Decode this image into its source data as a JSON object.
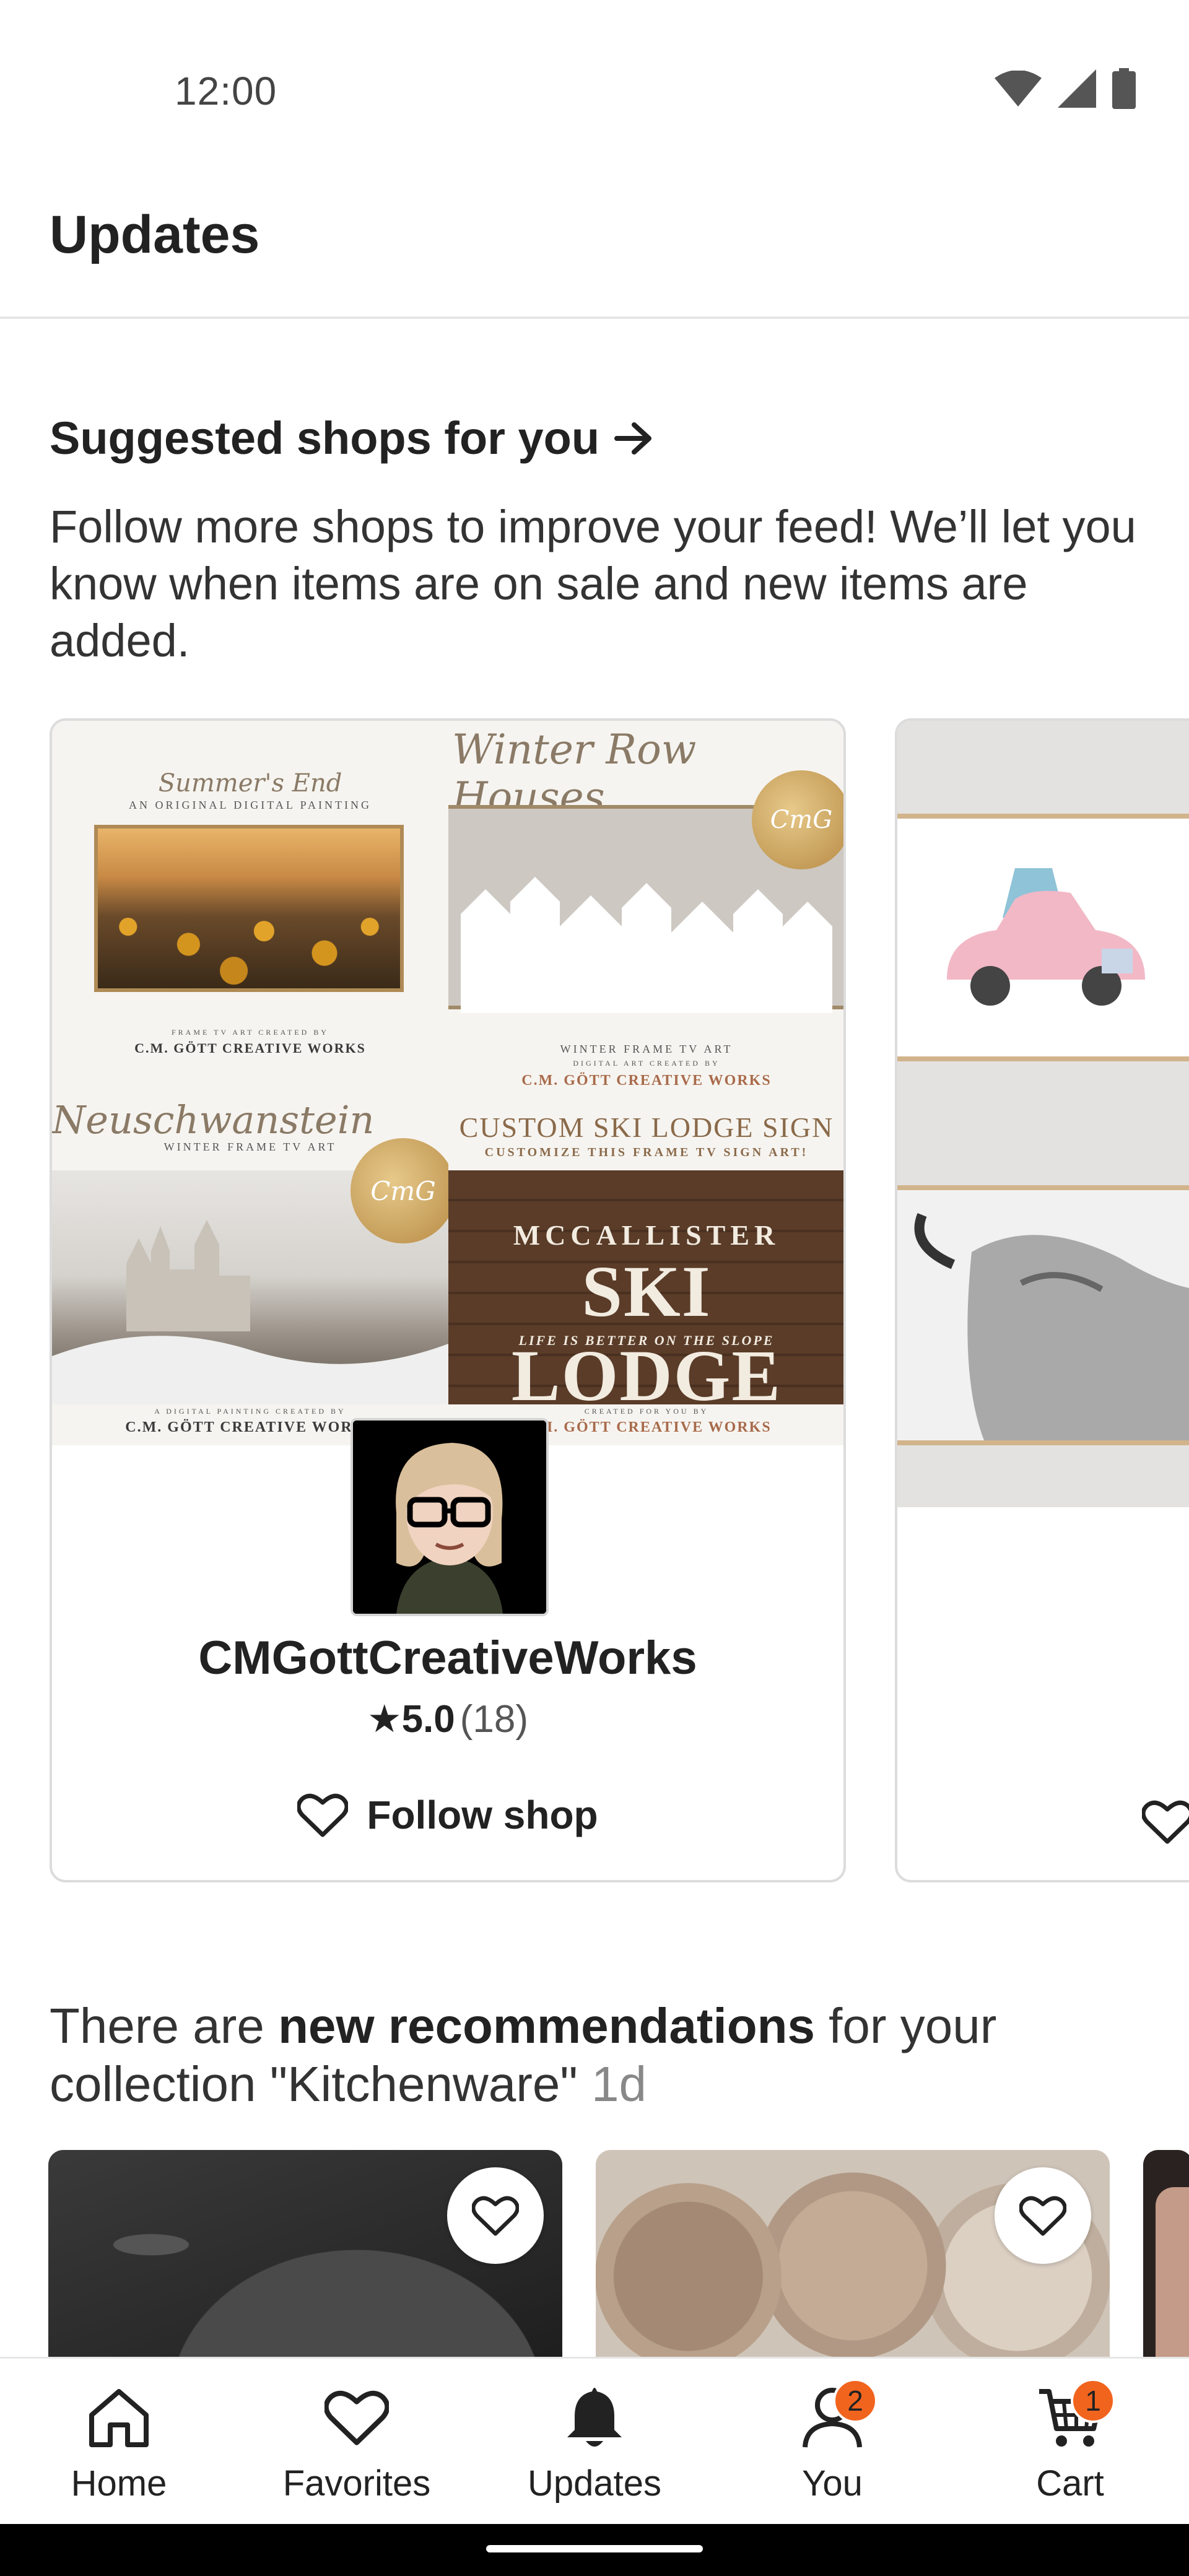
{
  "status_bar": {
    "time": "12:00",
    "icons": [
      "wifi-icon",
      "signal-icon",
      "battery-icon"
    ]
  },
  "header": {
    "title": "Updates"
  },
  "suggested_shops": {
    "heading": "Suggested shops for you",
    "heading_icon": "arrow-right-icon",
    "description": "Follow more shops to improve your feed! We’ll let you know when items are on sale and new items are added.",
    "shops": [
      {
        "name": "CMGottCreativeWorks",
        "rating_star": "★",
        "rating": "5.0",
        "review_count": "(18)",
        "follow_label": "Follow shop",
        "tiles": [
          {
            "script": "Summer's End",
            "sub": "AN ORIGINAL DIGITAL PAINTING",
            "credit_small": "FRAME TV ART CREATED BY",
            "credit": "C.M. GÖTT CREATIVE WORKS"
          },
          {
            "script": "Winter Row Houses",
            "sub": "WINTER FRAME TV ART",
            "credit_small": "DIGITAL ART CREATED BY",
            "credit": "C.M. GÖTT CREATIVE WORKS",
            "seal": "CmG"
          },
          {
            "script": "Neuschwanstein",
            "sub": "WINTER FRAME TV ART",
            "credit_small": "A DIGITAL PAINTING CREATED BY",
            "credit": "C.M. GÖTT CREATIVE WORKS",
            "seal": "CmG"
          },
          {
            "title": "CUSTOM SKI LODGE SIGN",
            "sub": "CUSTOMIZE THIS FRAME TV SIGN ART!",
            "sign_top": "MCCALLISTER",
            "sign_main": "SKI LODGE",
            "sign_tag": "LIFE IS BETTER ON THE SLOPE",
            "credit_small": "CREATED FOR YOU BY",
            "credit": "C.M. GÖTT CREATIVE WORKS"
          }
        ]
      }
    ]
  },
  "recommendations": {
    "prefix": "There are ",
    "bold": "new recommendations",
    "suffix": " for your collection \"Kitchenware\" ",
    "age": "1d"
  },
  "bottom_nav": [
    {
      "label": "Home",
      "icon": "home-icon"
    },
    {
      "label": "Favorites",
      "icon": "heart-icon"
    },
    {
      "label": "Updates",
      "icon": "bell-icon"
    },
    {
      "label": "You",
      "icon": "person-icon",
      "badge": "2"
    },
    {
      "label": "Cart",
      "icon": "cart-icon",
      "badge": "1"
    }
  ],
  "colors": {
    "badge": "#f1641e",
    "text": "#222222",
    "divider": "#e6e6e6"
  }
}
